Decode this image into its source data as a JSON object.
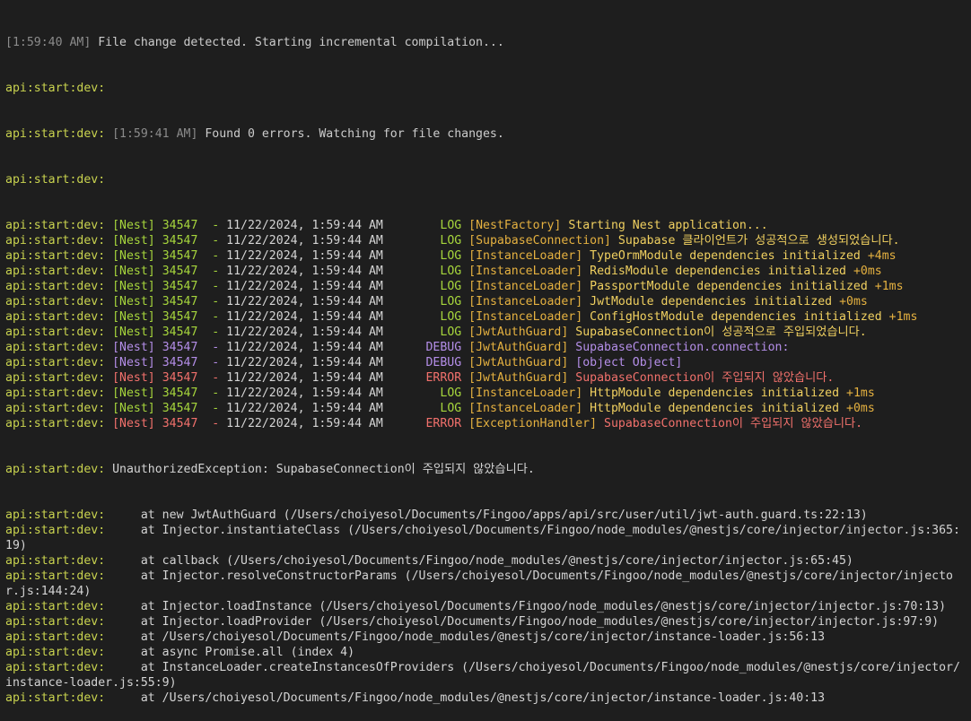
{
  "colors": {
    "background": "#1e1e1e",
    "prefix": "#c9d34f",
    "log": "#a6d53c",
    "context": "#e5b140",
    "debug": "#b48ee8",
    "error": "#f2716c"
  },
  "prefix": "api:start:dev:",
  "header": {
    "time1": "[1:59:40 AM]",
    "msg1": " File change detected. Starting incremental compilation...",
    "time2": "[1:59:41 AM]",
    "msg2": " Found 0 errors. Watching for file changes."
  },
  "nest_logs": [
    {
      "pid": "34547",
      "date": "11/22/2024, 1:59:44 AM",
      "level": "LOG",
      "context": "[NestFactory]",
      "msg": "Starting Nest application..."
    },
    {
      "pid": "34547",
      "date": "11/22/2024, 1:59:44 AM",
      "level": "LOG",
      "context": "[SupabaseConnection]",
      "msg": "Supabase 클라이언트가 성공적으로 생성되었습니다."
    },
    {
      "pid": "34547",
      "date": "11/22/2024, 1:59:44 AM",
      "level": "LOG",
      "context": "[InstanceLoader]",
      "msg": "TypeOrmModule dependencies initialized",
      "ms": "+4ms"
    },
    {
      "pid": "34547",
      "date": "11/22/2024, 1:59:44 AM",
      "level": "LOG",
      "context": "[InstanceLoader]",
      "msg": "RedisModule dependencies initialized",
      "ms": "+0ms"
    },
    {
      "pid": "34547",
      "date": "11/22/2024, 1:59:44 AM",
      "level": "LOG",
      "context": "[InstanceLoader]",
      "msg": "PassportModule dependencies initialized",
      "ms": "+1ms"
    },
    {
      "pid": "34547",
      "date": "11/22/2024, 1:59:44 AM",
      "level": "LOG",
      "context": "[InstanceLoader]",
      "msg": "JwtModule dependencies initialized",
      "ms": "+0ms"
    },
    {
      "pid": "34547",
      "date": "11/22/2024, 1:59:44 AM",
      "level": "LOG",
      "context": "[InstanceLoader]",
      "msg": "ConfigHostModule dependencies initialized",
      "ms": "+1ms"
    },
    {
      "pid": "34547",
      "date": "11/22/2024, 1:59:44 AM",
      "level": "LOG",
      "context": "[JwtAuthGuard]",
      "msg": "SupabaseConnection이 성공적으로 주입되었습니다."
    },
    {
      "pid": "34547",
      "date": "11/22/2024, 1:59:44 AM",
      "level": "DEBUG",
      "context": "[JwtAuthGuard]",
      "msg": "SupabaseConnection.connection:"
    },
    {
      "pid": "34547",
      "date": "11/22/2024, 1:59:44 AM",
      "level": "DEBUG",
      "context": "[JwtAuthGuard]",
      "msg": "[object Object]"
    },
    {
      "pid": "34547",
      "date": "11/22/2024, 1:59:44 AM",
      "level": "ERROR",
      "context": "[JwtAuthGuard]",
      "msg": "SupabaseConnection이 주입되지 않았습니다."
    },
    {
      "pid": "34547",
      "date": "11/22/2024, 1:59:44 AM",
      "level": "LOG",
      "context": "[InstanceLoader]",
      "msg": "HttpModule dependencies initialized",
      "ms": "+1ms"
    },
    {
      "pid": "34547",
      "date": "11/22/2024, 1:59:44 AM",
      "level": "LOG",
      "context": "[InstanceLoader]",
      "msg": "HttpModule dependencies initialized",
      "ms": "+0ms"
    },
    {
      "pid": "34547",
      "date": "11/22/2024, 1:59:44 AM",
      "level": "ERROR",
      "context": "[ExceptionHandler]",
      "msg": "SupabaseConnection이 주입되지 않았습니다."
    }
  ],
  "exception": "UnauthorizedException: SupabaseConnection이 주입되지 않았습니다.",
  "stack": [
    "    at new JwtAuthGuard (/Users/choiyesol/Documents/Fingoo/apps/api/src/user/util/jwt-auth.guard.ts:22:13)",
    "    at Injector.instantiateClass (/Users/choiyesol/Documents/Fingoo/node_modules/@nestjs/core/injector/injector.js:365:19)",
    "    at callback (/Users/choiyesol/Documents/Fingoo/node_modules/@nestjs/core/injector/injector.js:65:45)",
    "    at Injector.resolveConstructorParams (/Users/choiyesol/Documents/Fingoo/node_modules/@nestjs/core/injector/injector.js:144:24)",
    "    at Injector.loadInstance (/Users/choiyesol/Documents/Fingoo/node_modules/@nestjs/core/injector/injector.js:70:13)",
    "    at Injector.loadProvider (/Users/choiyesol/Documents/Fingoo/node_modules/@nestjs/core/injector/injector.js:97:9)",
    "    at /Users/choiyesol/Documents/Fingoo/node_modules/@nestjs/core/injector/instance-loader.js:56:13",
    "    at async Promise.all (index 4)",
    "    at InstanceLoader.createInstancesOfProviders (/Users/choiyesol/Documents/Fingoo/node_modules/@nestjs/core/injector/instance-loader.js:55:9)",
    "    at /Users/choiyesol/Documents/Fingoo/node_modules/@nestjs/core/injector/instance-loader.js:40:13"
  ]
}
